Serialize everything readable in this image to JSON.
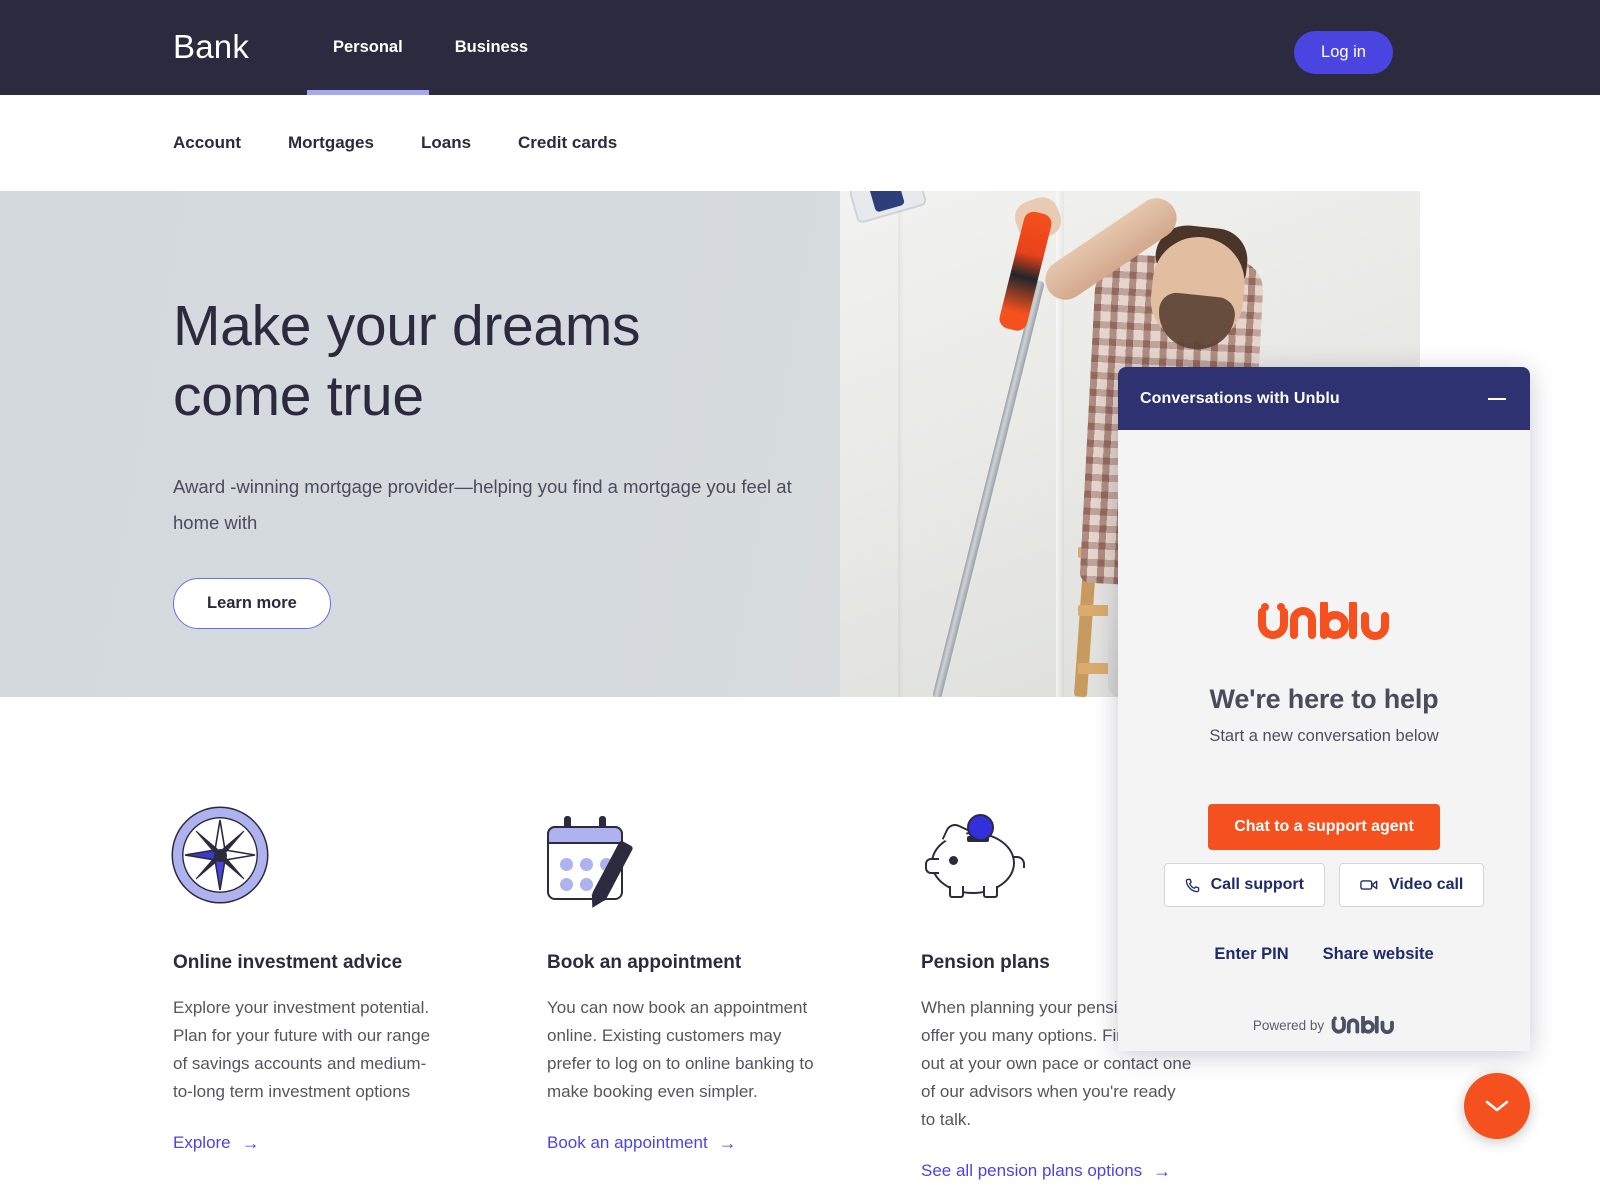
{
  "header": {
    "brand": "Bank",
    "nav": [
      {
        "label": "Personal",
        "active": true
      },
      {
        "label": "Business",
        "active": false
      }
    ],
    "login_label": "Log in"
  },
  "subnav": {
    "items": [
      {
        "label": "Account"
      },
      {
        "label": "Mortgages"
      },
      {
        "label": "Loans"
      },
      {
        "label": "Credit cards"
      }
    ]
  },
  "hero": {
    "title_line1": "Make your dreams",
    "title_line2": "come true",
    "subtitle": "Award -winning mortgage provider—helping you find a mortgage you feel at home with",
    "cta_label": "Learn more"
  },
  "cards": [
    {
      "icon": "compass-icon",
      "title": "Online investment advice",
      "text": "Explore your investment potential. Plan for your future with our range of savings accounts and medium-to-long term investment options",
      "link": "Explore",
      "arrow": "→"
    },
    {
      "icon": "calendar-pen-icon",
      "title": "Book an appointment",
      "text": "You can now book an appointment online. Existing customers may prefer to log on to online banking to make booking even simpler.",
      "link": "Book an appointment",
      "arrow": "→"
    },
    {
      "icon": "piggy-bank-icon",
      "title": "Pension plans",
      "text": "When planning your pension, we offer you many options. Find them out at your own pace or contact one of our advisors when you're ready to talk.",
      "link": "See all pension plans options",
      "arrow": "→"
    }
  ],
  "widget": {
    "title": "Conversations with Unblu",
    "minimize_label": "—",
    "logo_text": "unblu",
    "heading": "We're here to help",
    "subheading": "Start a new conversation below",
    "primary_button": "Chat to a support agent",
    "call_button": "Call support",
    "video_button": "Video call",
    "links": [
      {
        "label": "Enter PIN"
      },
      {
        "label": "Share website"
      }
    ],
    "powered_by": "Powered by",
    "powered_logo": "unblu"
  },
  "fab": {
    "icon": "chevron-down-icon"
  },
  "colors": {
    "topbar_bg": "#2b2a3e",
    "accent_indigo": "#4a45e0",
    "periwinkle": "#aeb2ee",
    "widget_header": "#2e3270",
    "unblu_orange": "#f4511e",
    "navy_text": "#1f2a6b",
    "hero_bg": "#d5dade"
  }
}
